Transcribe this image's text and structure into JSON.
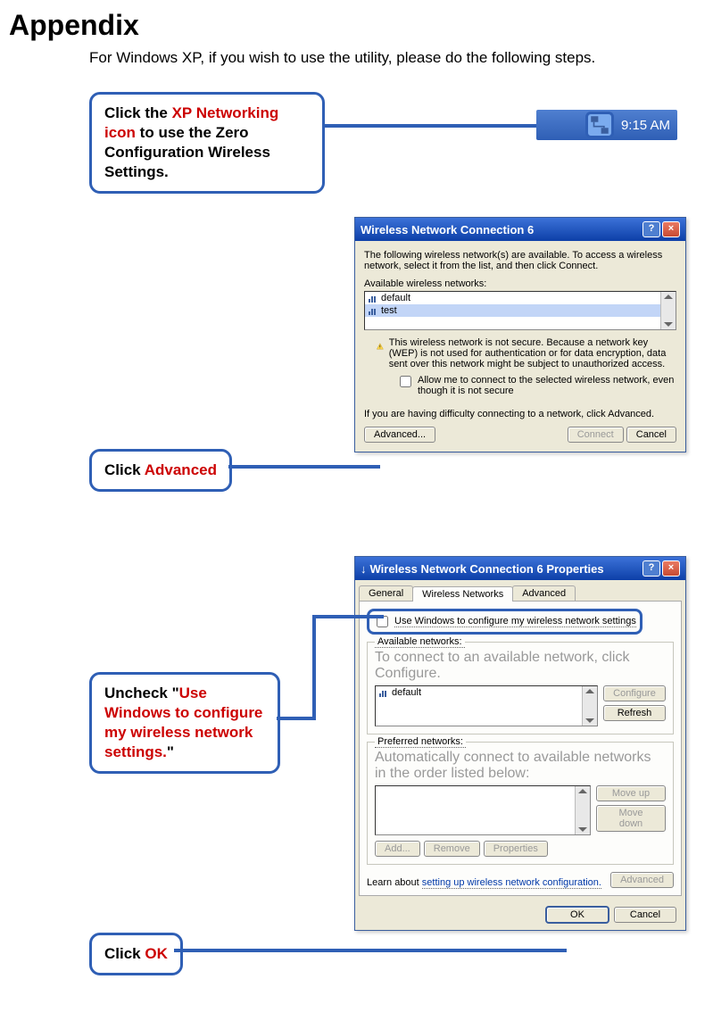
{
  "heading": "Appendix",
  "intro": "For Windows XP, if you wish to use the utility, please do the following steps.",
  "callouts": {
    "c1_a": "Click the ",
    "c1_b": "XP Networking icon",
    "c1_c": " to use the Zero Configuration Wireless Settings.",
    "c2_a": "Click ",
    "c2_b": "Advanced",
    "c3_a": "Uncheck \"",
    "c3_b": "Use Windows to configure my wireless network settings.",
    "c3_c": "\"",
    "c4_a": "Click ",
    "c4_b": "OK"
  },
  "tray_time": "9:15 AM",
  "dlg1": {
    "title": "Wireless Network Connection 6",
    "desc": "The following wireless network(s) are available. To access a wireless network, select it from the list, and then click Connect.",
    "avail_label": "Available wireless networks:",
    "networks": [
      "default",
      "test"
    ],
    "warn": "This wireless network is not secure. Because a network key (WEP) is not used for authentication or for data encryption, data sent over this network might be subject to unauthorized access.",
    "allow": "Allow me to connect to the selected wireless network, even though it is not secure",
    "difficulty": "If you are having difficulty connecting to a network, click Advanced.",
    "advanced": "Advanced...",
    "connect": "Connect",
    "cancel": "Cancel"
  },
  "dlg2": {
    "title": "Wireless Network Connection 6 Properties",
    "tabs": {
      "general": "General",
      "wireless": "Wireless Networks",
      "advanced": "Advanced"
    },
    "use_windows": "Use Windows to configure my wireless network settings",
    "avail_legend": "Available networks:",
    "avail_hint": "To connect to an available network, click Configure.",
    "avail_item": "default",
    "configure": "Configure",
    "refresh": "Refresh",
    "pref_legend": "Preferred networks:",
    "pref_hint": "Automatically connect to available networks in the order listed below:",
    "moveup": "Move up",
    "movedown": "Move down",
    "add": "Add...",
    "remove": "Remove",
    "properties": "Properties",
    "learn": "Learn about ",
    "learn_link": "setting up wireless network configuration.",
    "advanced_btn": "Advanced",
    "ok": "OK",
    "cancel": "Cancel"
  }
}
